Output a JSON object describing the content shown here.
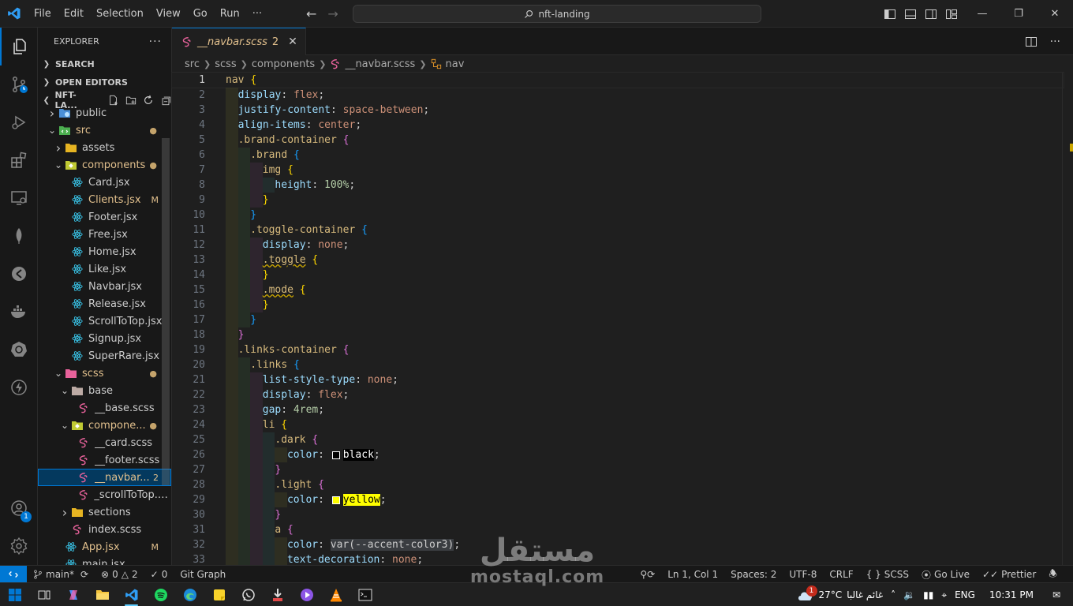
{
  "titlebar": {
    "menu": [
      "File",
      "Edit",
      "Selection",
      "View",
      "Go",
      "Run",
      "···"
    ],
    "search": "nft-landing"
  },
  "sidebar": {
    "title": "EXPLORER",
    "sections": {
      "search": "SEARCH",
      "open_editors": "OPEN EDITORS",
      "project": "NFT-LA..."
    },
    "tree": [
      {
        "label": "public",
        "type": "folder",
        "icon": "public-folder-icon",
        "depth": 0,
        "open": false,
        "deco": ""
      },
      {
        "label": "src",
        "type": "folder",
        "icon": "src-folder-icon",
        "depth": 0,
        "open": true,
        "deco": "dot",
        "color": "#e2c08d"
      },
      {
        "label": "assets",
        "type": "folder",
        "icon": "folder-icon",
        "depth": 1,
        "open": false,
        "deco": ""
      },
      {
        "label": "components",
        "type": "folder",
        "icon": "components-folder-icon",
        "depth": 1,
        "open": true,
        "deco": "dot",
        "color": "#e2c08d"
      },
      {
        "label": "Card.jsx",
        "type": "file",
        "icon": "react-icon",
        "depth": 2,
        "deco": ""
      },
      {
        "label": "Clients.jsx",
        "type": "file",
        "icon": "react-icon",
        "depth": 2,
        "deco": "M",
        "color": "#e2c08d"
      },
      {
        "label": "Footer.jsx",
        "type": "file",
        "icon": "react-icon",
        "depth": 2,
        "deco": ""
      },
      {
        "label": "Free.jsx",
        "type": "file",
        "icon": "react-icon",
        "depth": 2,
        "deco": ""
      },
      {
        "label": "Home.jsx",
        "type": "file",
        "icon": "react-icon",
        "depth": 2,
        "deco": ""
      },
      {
        "label": "Like.jsx",
        "type": "file",
        "icon": "react-icon",
        "depth": 2,
        "deco": ""
      },
      {
        "label": "Navbar.jsx",
        "type": "file",
        "icon": "react-icon",
        "depth": 2,
        "deco": ""
      },
      {
        "label": "Release.jsx",
        "type": "file",
        "icon": "react-icon",
        "depth": 2,
        "deco": ""
      },
      {
        "label": "ScrollToTop.jsx",
        "type": "file",
        "icon": "react-icon",
        "depth": 2,
        "deco": ""
      },
      {
        "label": "Signup.jsx",
        "type": "file",
        "icon": "react-icon",
        "depth": 2,
        "deco": ""
      },
      {
        "label": "SuperRare.jsx",
        "type": "file",
        "icon": "react-icon",
        "depth": 2,
        "deco": ""
      },
      {
        "label": "scss",
        "type": "folder",
        "icon": "scss-folder-icon",
        "depth": 1,
        "open": true,
        "deco": "dot",
        "color": "#e2c08d"
      },
      {
        "label": "base",
        "type": "folder",
        "icon": "base-folder-icon",
        "depth": 2,
        "open": true,
        "deco": ""
      },
      {
        "label": "__base.scss",
        "type": "file",
        "icon": "sass-icon",
        "depth": 3,
        "deco": ""
      },
      {
        "label": "compone...",
        "type": "folder",
        "icon": "components-folder-icon",
        "depth": 2,
        "open": true,
        "deco": "dot",
        "color": "#e2c08d"
      },
      {
        "label": "__card.scss",
        "type": "file",
        "icon": "sass-icon",
        "depth": 3,
        "deco": ""
      },
      {
        "label": "__footer.scss",
        "type": "file",
        "icon": "sass-icon",
        "depth": 3,
        "deco": ""
      },
      {
        "label": "__navbar...",
        "type": "file",
        "icon": "sass-icon",
        "depth": 3,
        "deco": "2",
        "selected": true,
        "color": "#e2c08d"
      },
      {
        "label": "_scrollToTop.s...",
        "type": "file",
        "icon": "sass-icon",
        "depth": 3,
        "deco": ""
      },
      {
        "label": "sections",
        "type": "folder",
        "icon": "folder-icon",
        "depth": 2,
        "open": false,
        "deco": ""
      },
      {
        "label": "index.scss",
        "type": "file",
        "icon": "sass-icon",
        "depth": 2,
        "deco": ""
      },
      {
        "label": "App.jsx",
        "type": "file",
        "icon": "react-icon",
        "depth": 1,
        "deco": "M",
        "color": "#e2c08d"
      },
      {
        "label": "main.jsx",
        "type": "file",
        "icon": "react-icon",
        "depth": 1,
        "deco": ""
      }
    ]
  },
  "editor": {
    "tab": {
      "name": "__navbar.scss",
      "problems": "2"
    },
    "breadcrumb": [
      "src",
      "scss",
      "components",
      "__navbar.scss",
      "nav"
    ],
    "active_line": 1,
    "lines": [
      {
        "n": 1,
        "ind": 0,
        "toks": [
          [
            "nav",
            "t-sel"
          ],
          [
            " ",
            ""
          ],
          [
            "{",
            "b1"
          ]
        ]
      },
      {
        "n": 2,
        "ind": 1,
        "toks": [
          [
            "display",
            "t-prop"
          ],
          [
            ": ",
            "t-punc"
          ],
          [
            "flex",
            "t-val"
          ],
          [
            ";",
            "t-punc"
          ]
        ]
      },
      {
        "n": 3,
        "ind": 1,
        "toks": [
          [
            "justify-content",
            "t-prop"
          ],
          [
            ": ",
            "t-punc"
          ],
          [
            "space-between",
            "t-val"
          ],
          [
            ";",
            "t-punc"
          ]
        ]
      },
      {
        "n": 4,
        "ind": 1,
        "toks": [
          [
            "align-items",
            "t-prop"
          ],
          [
            ": ",
            "t-punc"
          ],
          [
            "center",
            "t-val"
          ],
          [
            ";",
            "t-punc"
          ]
        ]
      },
      {
        "n": 5,
        "ind": 1,
        "toks": [
          [
            ".brand-container",
            "t-sel"
          ],
          [
            " ",
            ""
          ],
          [
            "{",
            "b2"
          ]
        ]
      },
      {
        "n": 6,
        "ind": 2,
        "toks": [
          [
            ".brand",
            "t-sel"
          ],
          [
            " ",
            ""
          ],
          [
            "{",
            "b3"
          ]
        ]
      },
      {
        "n": 7,
        "ind": 3,
        "toks": [
          [
            "img",
            "t-sel"
          ],
          [
            " ",
            ""
          ],
          [
            "{",
            "b1"
          ]
        ]
      },
      {
        "n": 8,
        "ind": 4,
        "toks": [
          [
            "height",
            "t-prop"
          ],
          [
            ": ",
            "t-punc"
          ],
          [
            "100%",
            "t-num"
          ],
          [
            ";",
            "t-punc"
          ]
        ]
      },
      {
        "n": 9,
        "ind": 3,
        "toks": [
          [
            "}",
            "b1"
          ]
        ]
      },
      {
        "n": 10,
        "ind": 2,
        "toks": [
          [
            "}",
            "b3"
          ]
        ]
      },
      {
        "n": 11,
        "ind": 2,
        "toks": [
          [
            ".toggle-container",
            "t-sel"
          ],
          [
            " ",
            ""
          ],
          [
            "{",
            "b3"
          ]
        ]
      },
      {
        "n": 12,
        "ind": 3,
        "toks": [
          [
            "display",
            "t-prop"
          ],
          [
            ": ",
            "t-punc"
          ],
          [
            "none",
            "t-val"
          ],
          [
            ";",
            "t-punc"
          ]
        ]
      },
      {
        "n": 13,
        "ind": 3,
        "toks": [
          [
            ".toggle",
            "t-sel squig"
          ],
          [
            " ",
            ""
          ],
          [
            "{",
            "b1"
          ]
        ]
      },
      {
        "n": 14,
        "ind": 3,
        "toks": [
          [
            "}",
            "b1"
          ]
        ]
      },
      {
        "n": 15,
        "ind": 3,
        "toks": [
          [
            ".mode",
            "t-sel squig"
          ],
          [
            " ",
            ""
          ],
          [
            "{",
            "b1"
          ]
        ]
      },
      {
        "n": 16,
        "ind": 3,
        "toks": [
          [
            "}",
            "b1"
          ]
        ]
      },
      {
        "n": 17,
        "ind": 2,
        "toks": [
          [
            "}",
            "b3"
          ]
        ]
      },
      {
        "n": 18,
        "ind": 1,
        "toks": [
          [
            "}",
            "b2"
          ]
        ]
      },
      {
        "n": 19,
        "ind": 1,
        "toks": [
          [
            ".links-container",
            "t-sel"
          ],
          [
            " ",
            ""
          ],
          [
            "{",
            "b2"
          ]
        ]
      },
      {
        "n": 20,
        "ind": 2,
        "toks": [
          [
            ".links",
            "t-sel"
          ],
          [
            " ",
            ""
          ],
          [
            "{",
            "b3"
          ]
        ]
      },
      {
        "n": 21,
        "ind": 3,
        "toks": [
          [
            "list-style-type",
            "t-prop"
          ],
          [
            ": ",
            "t-punc"
          ],
          [
            "none",
            "t-val"
          ],
          [
            ";",
            "t-punc"
          ]
        ]
      },
      {
        "n": 22,
        "ind": 3,
        "toks": [
          [
            "display",
            "t-prop"
          ],
          [
            ": ",
            "t-punc"
          ],
          [
            "flex",
            "t-val"
          ],
          [
            ";",
            "t-punc"
          ]
        ]
      },
      {
        "n": 23,
        "ind": 3,
        "toks": [
          [
            "gap",
            "t-prop"
          ],
          [
            ": ",
            "t-punc"
          ],
          [
            "4rem",
            "t-num"
          ],
          [
            ";",
            "t-punc"
          ]
        ]
      },
      {
        "n": 24,
        "ind": 3,
        "toks": [
          [
            "li",
            "t-sel"
          ],
          [
            " ",
            ""
          ],
          [
            "{",
            "b1"
          ]
        ]
      },
      {
        "n": 25,
        "ind": 4,
        "toks": [
          [
            ".dark",
            "t-sel"
          ],
          [
            " ",
            ""
          ],
          [
            "{",
            "b2"
          ]
        ]
      },
      {
        "n": 26,
        "ind": 5,
        "toks": [
          [
            "color",
            "t-prop"
          ],
          [
            ": ",
            "t-punc"
          ],
          [
            "#swatch:#000000",
            ""
          ],
          [
            "black",
            "hl-black"
          ],
          [
            ";",
            "t-punc"
          ]
        ]
      },
      {
        "n": 27,
        "ind": 4,
        "toks": [
          [
            "}",
            "b2"
          ]
        ]
      },
      {
        "n": 28,
        "ind": 4,
        "toks": [
          [
            ".light",
            "t-sel"
          ],
          [
            " ",
            ""
          ],
          [
            "{",
            "b2"
          ]
        ]
      },
      {
        "n": 29,
        "ind": 5,
        "toks": [
          [
            "color",
            "t-prop"
          ],
          [
            ": ",
            "t-punc"
          ],
          [
            "#swatch:#ffff00",
            ""
          ],
          [
            "yellow",
            "hl-yellow"
          ],
          [
            ";",
            "t-punc"
          ]
        ]
      },
      {
        "n": 30,
        "ind": 4,
        "toks": [
          [
            "}",
            "b2"
          ]
        ]
      },
      {
        "n": 31,
        "ind": 4,
        "toks": [
          [
            "a",
            "t-sel"
          ],
          [
            " ",
            ""
          ],
          [
            "{",
            "b2"
          ]
        ]
      },
      {
        "n": 32,
        "ind": 5,
        "toks": [
          [
            "color",
            "t-prop"
          ],
          [
            ": ",
            "t-punc"
          ],
          [
            "var(--accent-color3)",
            "hl-var"
          ],
          [
            ";",
            "t-punc"
          ]
        ]
      },
      {
        "n": 33,
        "ind": 5,
        "toks": [
          [
            "text-decoration",
            "t-prop"
          ],
          [
            ": ",
            "t-punc"
          ],
          [
            "none",
            "t-val"
          ],
          [
            ";",
            "t-punc"
          ]
        ]
      }
    ]
  },
  "statusbar": {
    "branch": "main*",
    "errors": "0",
    "warnings": "2",
    "ports": "0",
    "git_graph": "Git Graph",
    "position": "Ln 1, Col 1",
    "spaces": "Spaces: 2",
    "encoding": "UTF-8",
    "eol": "CRLF",
    "language": "SCSS",
    "golive": "Go Live",
    "prettier": "Prettier"
  },
  "taskbar": {
    "temp": "27°C",
    "weather": "غائم غالبا",
    "lang": "ENG",
    "time": "10:31 PM",
    "weather_badge": "1"
  },
  "activity_badge": "1",
  "watermark": {
    "ar": "مستقل",
    "en": "mostaql.com"
  },
  "colors": {
    "accent": "#0078d4",
    "modified": "#e2c08d",
    "selector": "#d7ba7d",
    "property": "#9cdcfe",
    "value": "#ce9178"
  }
}
